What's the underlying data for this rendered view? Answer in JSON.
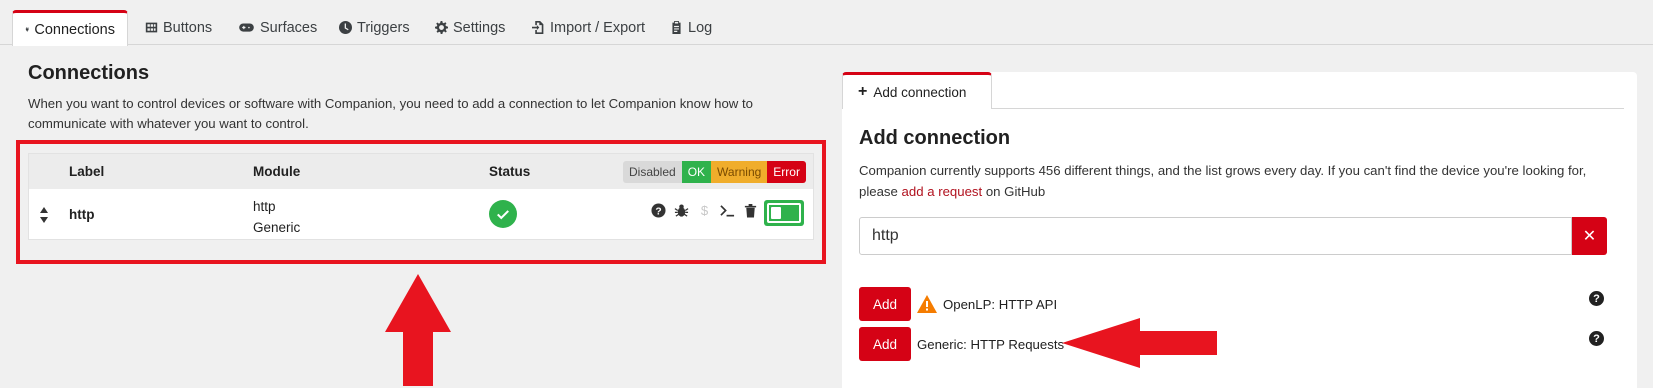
{
  "tabs": [
    {
      "label": "Connections",
      "icon": "plug-icon"
    },
    {
      "label": "Buttons",
      "icon": "grid-icon"
    },
    {
      "label": "Surfaces",
      "icon": "gamepad-icon"
    },
    {
      "label": "Triggers",
      "icon": "clock-icon"
    },
    {
      "label": "Settings",
      "icon": "cog-icon"
    },
    {
      "label": "Import / Export",
      "icon": "file-import-icon"
    },
    {
      "label": "Log",
      "icon": "clipboard-icon"
    }
  ],
  "connections": {
    "title": "Connections",
    "description": "When you want to control devices or software with Companion, you need to add a connection to let Companion know how to communicate with whatever you want to control.",
    "table": {
      "headers": {
        "label": "Label",
        "module": "Module",
        "status": "Status"
      },
      "filters": {
        "disabled": "Disabled",
        "ok": "OK",
        "warning": "Warning",
        "error": "Error"
      },
      "rows": [
        {
          "label": "http",
          "module_name": "http",
          "module_type": "Generic",
          "status": "ok",
          "enabled": true
        }
      ]
    }
  },
  "add_connection": {
    "tab_label": "Add connection",
    "title": "Add connection",
    "description_pre": "Companion currently supports 456 different things, and the list grows every day. If you can't find the device you're looking for, please ",
    "description_link": "add a request",
    "description_post": " on GitHub",
    "search_value": "http",
    "results": [
      {
        "button": "Add",
        "label": "OpenLP: HTTP API",
        "warning": true
      },
      {
        "button": "Add",
        "label": "Generic: HTTP Requests",
        "warning": false
      }
    ]
  },
  "colors": {
    "accent": "#d50215",
    "ok": "#2fb24c",
    "warning": "#f0ad2b",
    "annotation": "#e8141f"
  }
}
